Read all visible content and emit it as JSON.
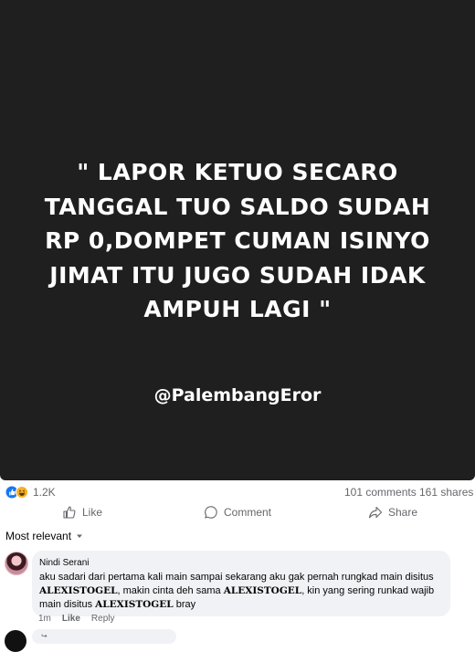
{
  "post": {
    "quote_lines": [
      "\" LAPOR KETUO SECARO",
      "TANGGAL TUO SALDO SUDAH",
      "RP 0,DOMPET CUMAN ISINYO",
      "JIMAT ITU JUGO SUDAH IDAK",
      "AMPUH LAGI \""
    ],
    "handle": "@PalembangEror",
    "background_color": "#1f1f1f"
  },
  "stats": {
    "reactions": "1.2K",
    "reaction_icons": [
      "like-icon",
      "haha-icon"
    ],
    "comments": "101 comments",
    "shares": "161 shares"
  },
  "actions": {
    "like": "Like",
    "comment": "Comment",
    "share": "Share"
  },
  "sort": {
    "label": "Most relevant"
  },
  "comment": {
    "author": "Nindi Serani",
    "text_1": "aku sadari dari pertama kali main sampai sekarang aku gak pernah rungkad main disitus",
    "brand": "ALEXISTOGEL",
    "text_2": ", makin cinta deh sama",
    "text_3": ", kin yang sering runkad wajib",
    "text_4": "main disitus",
    "text_5": "bray",
    "time": "1m",
    "like": "Like",
    "reply": "Reply"
  },
  "colors": {
    "accent": "#1877f2",
    "muted_text": "#65676b",
    "bubble": "#f0f2f5"
  }
}
